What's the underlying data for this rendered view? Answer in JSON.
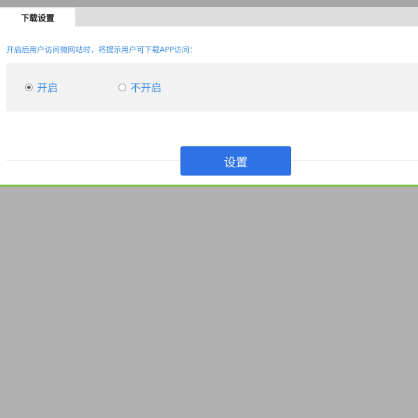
{
  "tabs": {
    "active_label": "下载设置"
  },
  "settings": {
    "hint": "开启后用户访问微网站时，将提示用户可下载APP访问：",
    "options": [
      {
        "label": "开启",
        "checked": true
      },
      {
        "label": "不开启",
        "checked": false
      }
    ],
    "submit_label": "设置"
  },
  "colors": {
    "accent_blue": "#2d73e6",
    "hint_blue": "#3a8be0",
    "panel_border_green": "#7dc142",
    "backdrop_gray": "#b0b0b0"
  }
}
